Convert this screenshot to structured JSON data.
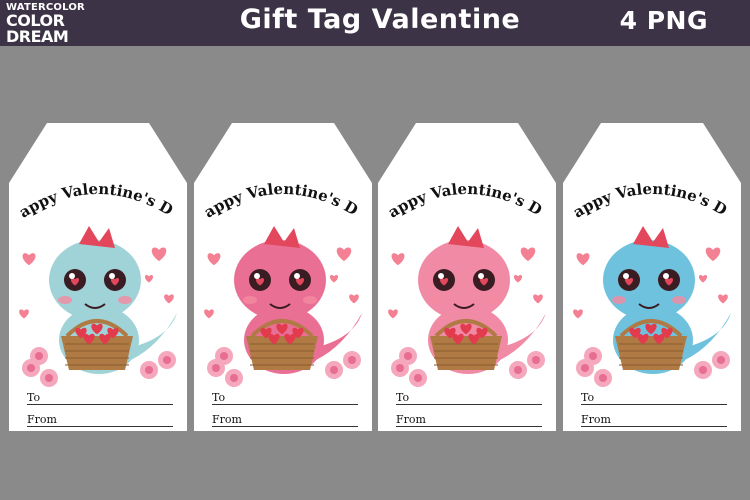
{
  "header": {
    "logo": {
      "line1": "WATERCOLOR",
      "line2": "COLOR",
      "line3": "DREAM"
    },
    "title": "Gift Tag Valentine",
    "count_badge": "4 PNG"
  },
  "tags": [
    {
      "greeting": "Happy Valentine's Day",
      "dino": "blue-dinosaur-with-heart-basket",
      "body_color": "#9fd3d8",
      "to_label": "To",
      "from_label": "From"
    },
    {
      "greeting": "Happy Valentine's Day",
      "dino": "pink-dinosaur-with-heart-basket",
      "body_color": "#ea6f95",
      "to_label": "To",
      "from_label": "From"
    },
    {
      "greeting": "Happy Valentine's Day",
      "dino": "pink-dinosaur-with-heart-basket",
      "body_color": "#f08aa5",
      "to_label": "To",
      "from_label": "From"
    },
    {
      "greeting": "Happy Valentine's Day",
      "dino": "blue-dinosaur-with-heart-basket",
      "body_color": "#6fc2de",
      "to_label": "To",
      "from_label": "From"
    }
  ],
  "colors": {
    "header_bg": "#3d3346",
    "page_bg": "#8a8a8a",
    "tag_bg": "#ffffff",
    "heart": "#e23b4e",
    "basket": "#b07a45"
  }
}
